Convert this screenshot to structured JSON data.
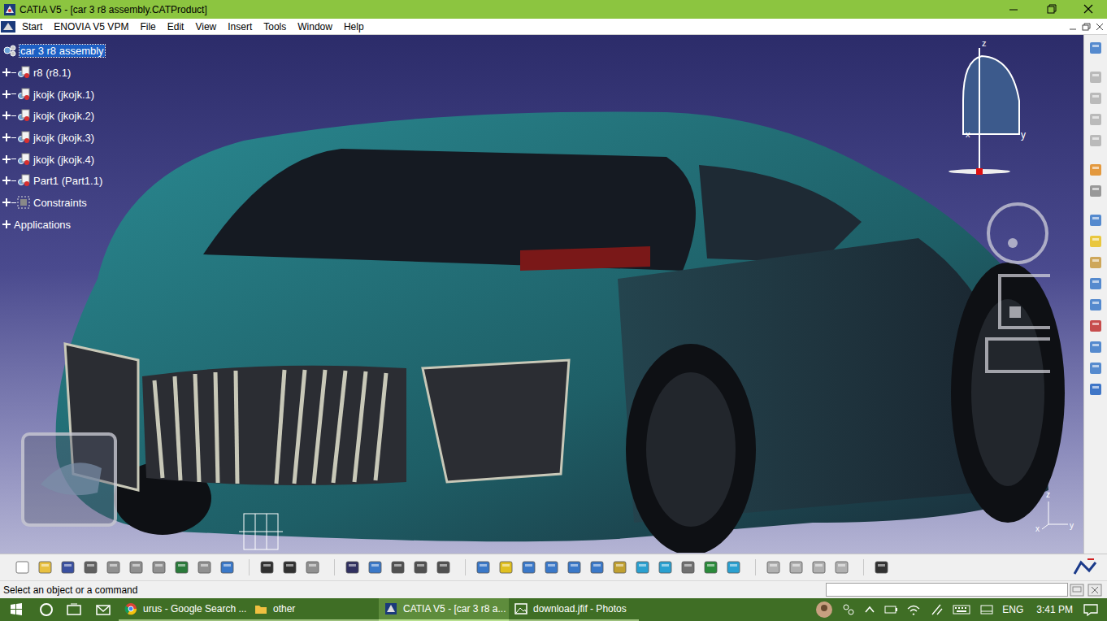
{
  "window": {
    "title": "CATIA V5 - [car 3 r8 assembly.CATProduct]"
  },
  "menu": [
    {
      "label": "Start"
    },
    {
      "label": "ENOVIA V5 VPM"
    },
    {
      "label": "File"
    },
    {
      "label": "Edit"
    },
    {
      "label": "View"
    },
    {
      "label": "Insert"
    },
    {
      "label": "Tools"
    },
    {
      "label": "Window"
    },
    {
      "label": "Help"
    }
  ],
  "tree": [
    {
      "label": "car 3 r8 assembly",
      "kind": "root",
      "selected": true
    },
    {
      "label": "r8 (r8.1)",
      "kind": "part",
      "selected": false
    },
    {
      "label": "jkojk (jkojk.1)",
      "kind": "part",
      "selected": false
    },
    {
      "label": "jkojk (jkojk.2)",
      "kind": "part",
      "selected": false
    },
    {
      "label": "jkojk (jkojk.3)",
      "kind": "part",
      "selected": false
    },
    {
      "label": "jkojk (jkojk.4)",
      "kind": "part",
      "selected": false
    },
    {
      "label": "Part1 (Part1.1)",
      "kind": "part",
      "selected": false
    },
    {
      "label": "Constraints",
      "kind": "constraints",
      "selected": false
    },
    {
      "label": "Applications",
      "kind": "applications",
      "selected": false
    }
  ],
  "compass": {
    "labels": [
      "z",
      "x",
      "y"
    ]
  },
  "axis": {
    "labels": [
      "z",
      "x",
      "y"
    ]
  },
  "status_bar": {
    "prompt": "Select an object or a command",
    "input": ""
  },
  "taskbar": {
    "apps": [
      {
        "label": "urus - Google Search ...",
        "kind": "chrome",
        "selected": false
      },
      {
        "label": "other",
        "kind": "folder",
        "selected": false
      },
      {
        "label": "CATIA V5 - [car 3 r8 a...",
        "kind": "catia",
        "selected": true
      },
      {
        "label": "download.jfif - Photos",
        "kind": "photos",
        "selected": false
      }
    ],
    "language": "ENG",
    "time": "3:41 PM"
  }
}
